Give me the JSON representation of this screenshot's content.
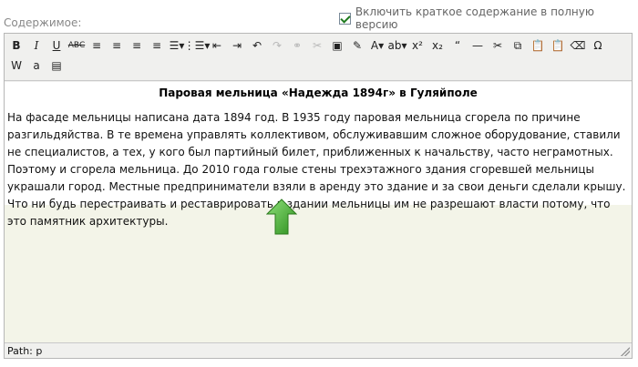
{
  "form": {
    "field_label": "Содержимое:",
    "checkbox_label": "Включить краткое содержание в полную версию",
    "checkbox_checked": true
  },
  "toolbar": {
    "row1": [
      {
        "name": "bold-button",
        "glyph": "B",
        "cls": "b"
      },
      {
        "name": "italic-button",
        "glyph": "I",
        "cls": "i"
      },
      {
        "name": "underline-button",
        "glyph": "U",
        "cls": "u"
      },
      {
        "name": "strikethrough-button",
        "glyph": "ABC",
        "cls": "s"
      },
      {
        "name": "align-left-button",
        "glyph": "≡"
      },
      {
        "name": "align-center-button",
        "glyph": "≡"
      },
      {
        "name": "align-right-button",
        "glyph": "≡"
      },
      {
        "name": "align-justify-button",
        "glyph": "≡"
      },
      {
        "name": "bullet-list-button",
        "glyph": "☰▾"
      },
      {
        "name": "numbered-list-button",
        "glyph": "⋮☰▾"
      },
      {
        "name": "outdent-button",
        "glyph": "⇤"
      },
      {
        "name": "indent-button",
        "glyph": "⇥"
      },
      {
        "name": "undo-button",
        "glyph": "↶"
      },
      {
        "name": "redo-button",
        "glyph": "↷",
        "cls": "dis"
      },
      {
        "name": "link-button",
        "glyph": "⚭",
        "cls": "dis"
      },
      {
        "name": "unlink-button",
        "glyph": "✂",
        "cls": "dis"
      },
      {
        "name": "image-button",
        "glyph": "▣"
      },
      {
        "name": "cleanup-button",
        "glyph": "✎"
      },
      {
        "name": "text-color-button",
        "glyph": "A▾"
      },
      {
        "name": "highlight-color-button",
        "glyph": "ab▾"
      },
      {
        "name": "superscript-button",
        "glyph": "x²"
      },
      {
        "name": "subscript-button",
        "glyph": "x₂"
      },
      {
        "name": "blockquote-button",
        "glyph": "“"
      },
      {
        "name": "horizontal-rule-button",
        "glyph": "—"
      },
      {
        "name": "cut-button",
        "glyph": "✂"
      },
      {
        "name": "copy-button",
        "glyph": "⧉"
      },
      {
        "name": "paste-button",
        "glyph": "📋"
      },
      {
        "name": "paste-text-button",
        "glyph": "📋"
      },
      {
        "name": "eraser-button",
        "glyph": "⌫"
      },
      {
        "name": "special-char-button",
        "glyph": "Ω"
      }
    ],
    "row2": [
      {
        "name": "paste-word-button",
        "glyph": "W"
      },
      {
        "name": "paste-plain-button",
        "glyph": "a"
      },
      {
        "name": "media-button",
        "glyph": "▤"
      }
    ]
  },
  "document": {
    "title": "Паровая мельница «Надежда 1894г» в Гуляйполе",
    "paragraph": "На фасаде мельницы написана дата 1894 год. В 1935 году паровая мельница сгорела по причине разгильдяйства. В те времена управлять коллективом, обслуживавшим сложное оборудование, ставили не специалистов, а тех, у кого был партийный билет, приближенных к начальству, часто неграмотных. Поэтому и сгорела мельница. До 2010 года голые стены трехэтажного здания сгоревшей мельницы украшали город. Местные предприниматели взяли в аренду это здание и за свои деньги сделали крышу. Что ни будь перестраивать и реставрировать в здании мельницы им не разрешают власти потому, что это памятник архитектуры."
  },
  "status": {
    "path": "Path: p"
  },
  "colors": {
    "accent_green": "#3fa52a",
    "editor_bg": "#f0f0ee"
  }
}
